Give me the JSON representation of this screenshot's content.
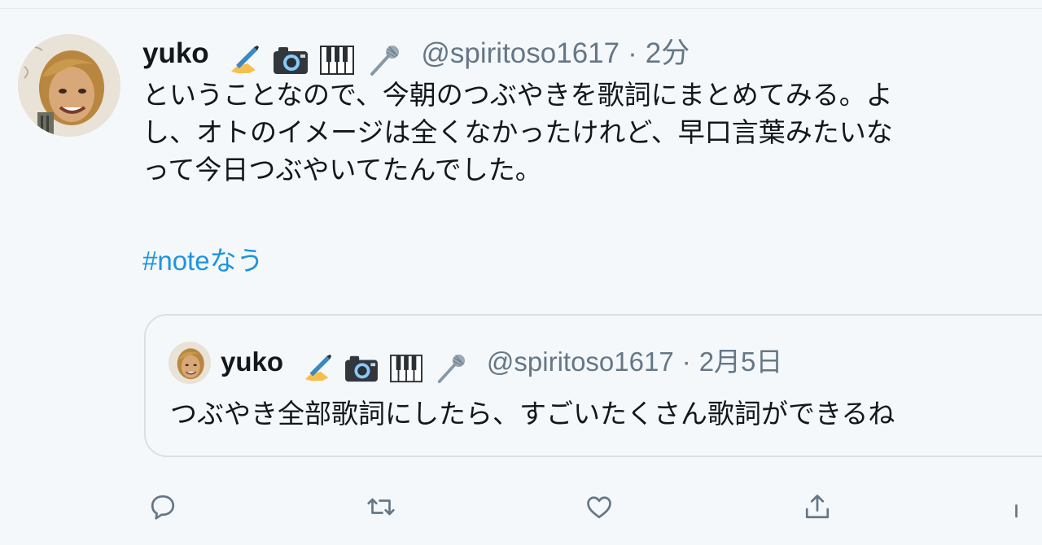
{
  "tweet": {
    "user": {
      "name": "yuko",
      "badges": [
        "writing-hand-emoji",
        "camera-emoji",
        "piano-keys-emoji",
        "microphone-emoji"
      ],
      "handle": "@spiritoso1617",
      "separator": "·",
      "time": "2分"
    },
    "text_lines": [
      "ということなので、今朝のつぶやきを歌詞にまとめてみる。よ",
      "し、オトのイメージは全くなかったけれど、早口言葉みたいな",
      "って今日つぶやいてたんでした。"
    ],
    "hashtag": "#noteなう",
    "quoted": {
      "name": "yuko",
      "handle": "@spiritoso1617",
      "separator": "·",
      "time": "2月5日",
      "text": "つぶやき全部歌詞にしたら、すごいたくさん歌詞ができるね"
    },
    "actions": [
      "reply-icon",
      "retweet-icon",
      "like-icon",
      "share-icon",
      "analytics-icon"
    ]
  },
  "colors": {
    "text": "#14171a",
    "secondary": "#657786",
    "link": "#1b95e0",
    "background": "#f5f8fa",
    "border": "#d8e0e6"
  }
}
